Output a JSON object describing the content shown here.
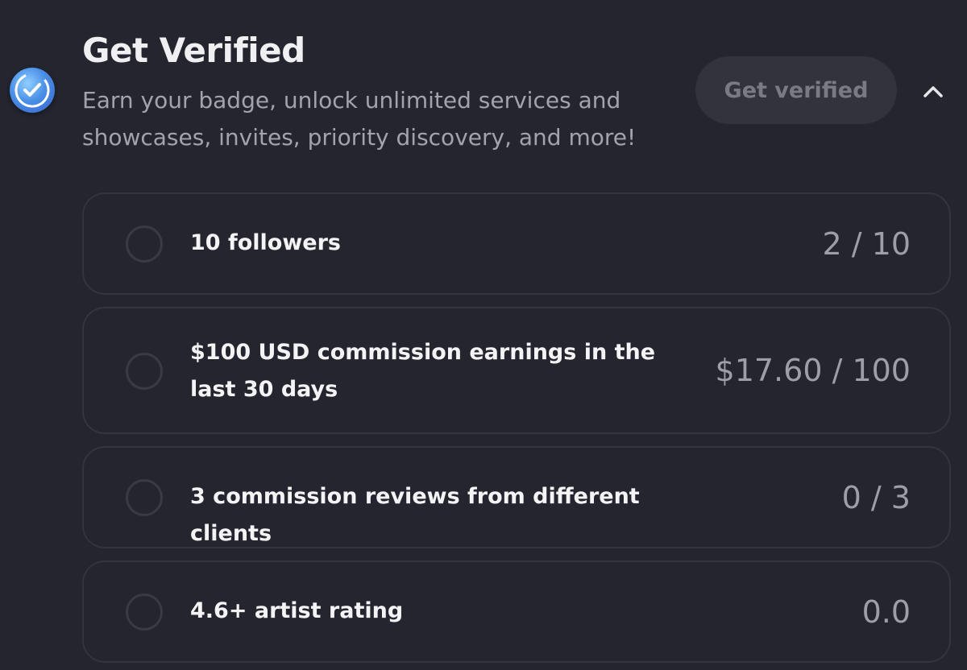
{
  "header": {
    "badge_icon": "verified-check-icon",
    "title": "Get Verified",
    "subtitle": "Earn your badge, unlock unlimited services and showcases, invites, priority discovery, and more!",
    "button_label": "Get verified",
    "collapse_icon": "chevron-up-icon"
  },
  "requirements": [
    {
      "label": "10 followers",
      "progress": "2 / 10"
    },
    {
      "label": "$100 USD commission earnings in the last 30 days",
      "progress": "$17.60 / 100"
    },
    {
      "label": "3 commission reviews from different clients",
      "progress": "0 / 3"
    },
    {
      "label": "4.6+ artist rating",
      "progress": "0.0"
    }
  ],
  "colors": {
    "background": "#25252f",
    "card_border": "#34343f",
    "badge_blue": "#4a8fe8",
    "progress_text": "#9e9ea8"
  }
}
